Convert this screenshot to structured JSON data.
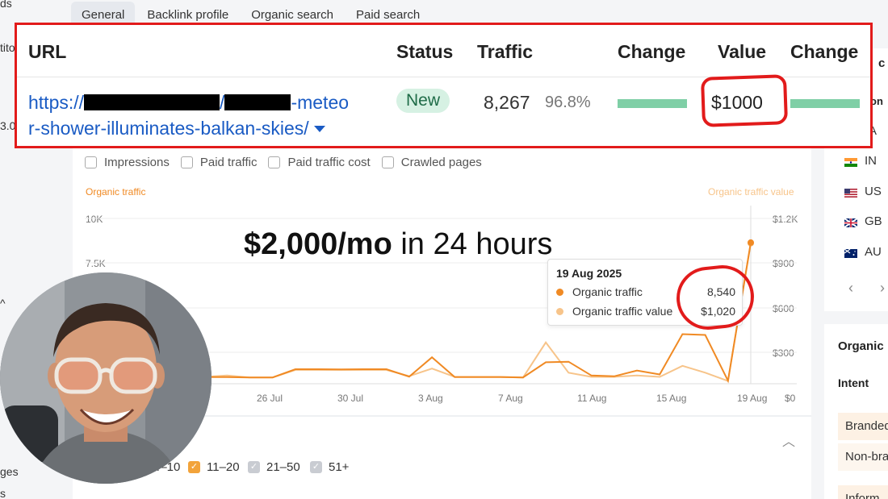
{
  "sidebar_fragments": [
    "ds",
    "tito",
    "3.0",
    "^",
    "ges",
    "s"
  ],
  "tabs": [
    {
      "label": "General",
      "active": true
    },
    {
      "label": "Backlink profile",
      "active": false
    },
    {
      "label": "Organic search",
      "active": false
    },
    {
      "label": "Paid search",
      "active": false
    }
  ],
  "url_card": {
    "headers": {
      "url": "URL",
      "status": "Status",
      "traffic": "Traffic",
      "change1": "Change",
      "value": "Value",
      "change2": "Change"
    },
    "url_line1_start": "https://",
    "url_line1_mid": "/",
    "url_line1_end": "-meteo",
    "url_line2": "r-shower-illuminates-balkan-skies/",
    "status": "New",
    "traffic": "8,267",
    "traffic_pct": "96.8%",
    "value": "$1000"
  },
  "checkboxes": [
    "Impressions",
    "Paid traffic",
    "Paid traffic cost",
    "Crawled pages"
  ],
  "chart_labels": {
    "left_series": "Organic traffic",
    "right_series": "Organic traffic value"
  },
  "headline": {
    "bold": "$2,000/mo",
    "rest": "in 24 hours"
  },
  "tooltip": {
    "date": "19 Aug 2025",
    "rows": [
      {
        "label": "Organic traffic",
        "value": "8,540",
        "color": "#f08a24"
      },
      {
        "label": "Organic traffic value",
        "value": "$1,020",
        "color": "#f7c48a"
      }
    ]
  },
  "chart_data": {
    "type": "line",
    "title": "",
    "x_tick_labels": [
      "26 Jul",
      "30 Jul",
      "3 Aug",
      "7 Aug",
      "11 Aug",
      "15 Aug",
      "19 Aug"
    ],
    "y_left_ticks": [
      "10K",
      "7.5K"
    ],
    "y_right_ticks": [
      "$1.2K",
      "$900",
      "$600",
      "$300",
      "$0"
    ],
    "y_left_range": [
      0,
      10000
    ],
    "y_right_range": [
      0,
      1200
    ],
    "grid": true,
    "series": [
      {
        "name": "Organic traffic",
        "color": "#f08a24",
        "axis": "left",
        "values": [
          1650,
          1100,
          850,
          480,
          450,
          400,
          400,
          380,
          380,
          880,
          880,
          870,
          880,
          880,
          430,
          1600,
          400,
          400,
          400,
          380,
          1300,
          1330,
          500,
          450,
          800,
          560,
          3000,
          2950,
          180,
          8540
        ]
      },
      {
        "name": "Organic traffic value",
        "color": "#f7c48a",
        "axis": "right",
        "values": [
          280,
          260,
          220,
          60,
          170,
          50,
          60,
          45,
          45,
          100,
          100,
          100,
          100,
          100,
          55,
          110,
          50,
          50,
          50,
          45,
          300,
          80,
          50,
          50,
          60,
          50,
          130,
          80,
          20,
          1020
        ]
      }
    ]
  },
  "position_filters": [
    "4–10",
    "11–20",
    "21–50",
    "51+"
  ],
  "right_panel": {
    "header_fragment": "c by",
    "sub_fragment": "on",
    "countries": [
      {
        "code": "A",
        "flag": "partial"
      },
      {
        "code": "IN",
        "flag": "in"
      },
      {
        "code": "US",
        "flag": "us"
      },
      {
        "code": "GB",
        "flag": "gb"
      },
      {
        "code": "AU",
        "flag": "au"
      }
    ],
    "organic_header": "Organic",
    "intent_label": "Intent",
    "intent_rows": [
      "Branded",
      "Non-bra",
      "Inform"
    ]
  },
  "colors": {
    "accent_red": "#e21b1b",
    "orange": "#f08a24",
    "light_orange": "#f7c48a",
    "green": "#7fcfa6",
    "link": "#1a5bc4"
  }
}
